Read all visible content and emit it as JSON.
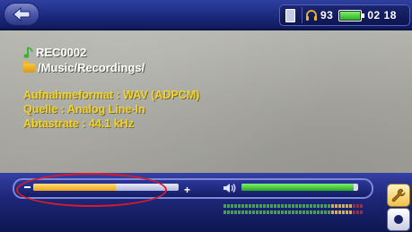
{
  "status": {
    "headphone_volume": "93",
    "battery_level": 1.0,
    "clock": "02 18"
  },
  "file": {
    "name": "REC0002",
    "folder": "/Music/Recordings/"
  },
  "details": [
    "Aufnahmeformat : WAV (ADPCM)",
    "Quelle : Analog Line-In",
    "Abtastrate : 44.1 kHz"
  ],
  "playback": {
    "minus_label": "–",
    "plus_label": "+",
    "progress_fraction": 0.57,
    "volume_fraction": 0.96
  },
  "level_meters": [
    {
      "green": 30,
      "yellow": 6,
      "red": 3
    },
    {
      "green": 30,
      "yellow": 6,
      "red": 3
    }
  ],
  "colors": {
    "detail_text": "#f3d22a",
    "highlight": "#d81a2a",
    "meter_green": "#3ab02a",
    "meter_yellow": "#e8b020",
    "meter_red": "#c02020"
  },
  "icons": [
    "back-icon",
    "memory-card-icon",
    "headphone-icon",
    "battery-icon",
    "music-note-icon",
    "folder-icon",
    "speaker-icon",
    "settings-wrench-icon",
    "record-icon"
  ]
}
